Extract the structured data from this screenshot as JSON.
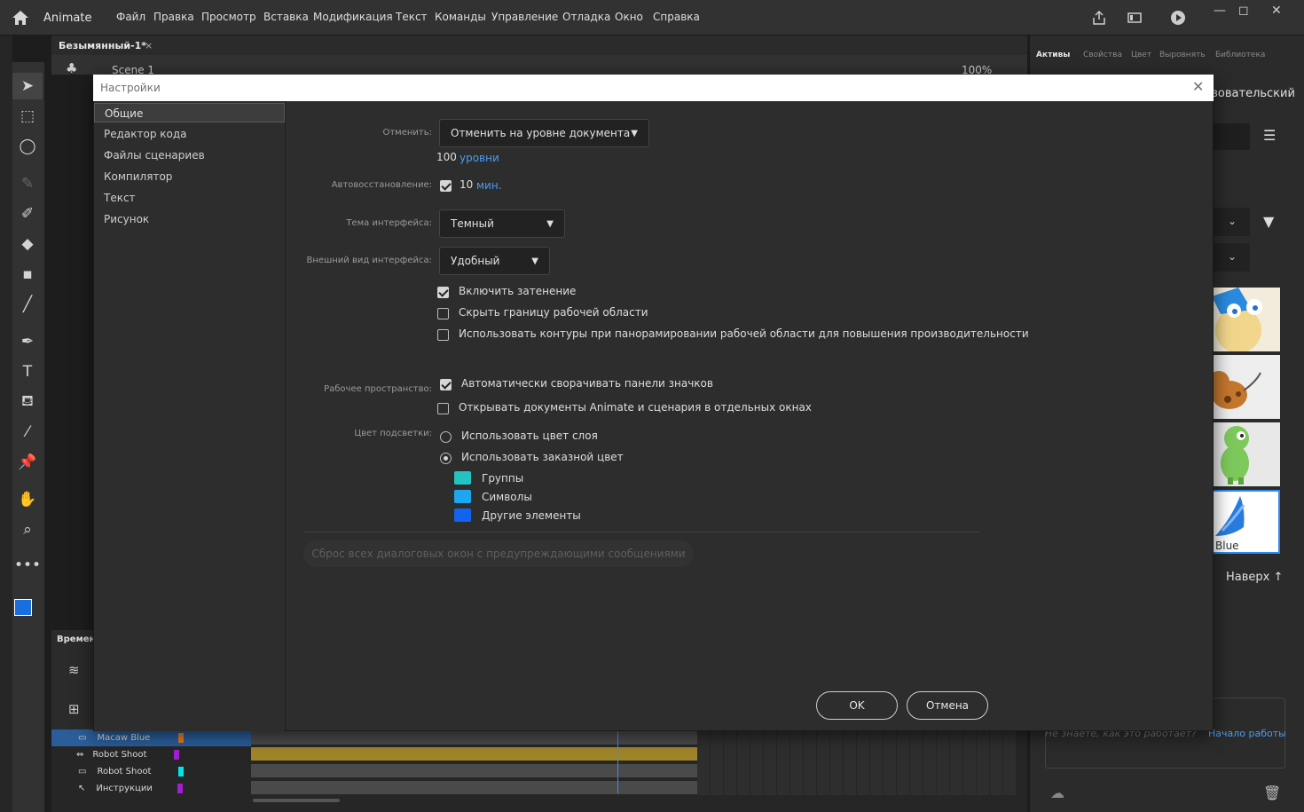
{
  "app": {
    "name": "Animate",
    "menu": [
      "Файл",
      "Правка",
      "Просмотр",
      "Вставка",
      "Модификация",
      "Текст",
      "Команды",
      "Управление",
      "Отладка",
      "Окно",
      "Справка"
    ]
  },
  "document": {
    "tab_title": "Безымянный-1*",
    "scene": "Scene 1",
    "zoom": "100%"
  },
  "right_panel": {
    "tabs": [
      "Активы",
      "Свойства",
      "Цвет",
      "Выровнять",
      "Библиотека"
    ],
    "partial_title": "зовательский",
    "thumb_label": "Blue",
    "up_label": "Наверх",
    "hint_text": "Не знаете, как это работает?",
    "hint_link": "Начало работы"
  },
  "timeline": {
    "label": "Времен",
    "layers": [
      {
        "name": "Macaw Blue",
        "color": "#e87d1e"
      },
      {
        "name": "Robot Shoot",
        "color": "#a020d0"
      },
      {
        "name": "Robot Shoot",
        "color": "#00e5e5"
      },
      {
        "name": "Инструкции",
        "color": "#a020d0"
      }
    ]
  },
  "dialog": {
    "title": "Настройки",
    "categories": [
      "Общие",
      "Редактор кода",
      "Файлы сценариев",
      "Компилятор",
      "Текст",
      "Рисунок"
    ],
    "undo_label": "Отменить:",
    "undo_value": "Отменить на уровне документа",
    "undo_levels_num": "100",
    "undo_levels_unit": "уровни",
    "autorecover_label": "Автовосстановление:",
    "autorecover_num": "10",
    "autorecover_unit": "мин.",
    "theme_label": "Тема интерфейса:",
    "theme_value": "Темный",
    "look_label": "Внешний вид интерфейса:",
    "look_value": "Удобный",
    "opt_shading": "Включить затенение",
    "opt_hide_border": "Скрыть границу рабочей области",
    "opt_outlines": "Использовать контуры при панорамировании рабочей области для повышения производительности",
    "workspace_label": "Рабочее пространство:",
    "ws_autocollapse": "Автоматически сворачивать панели значков",
    "ws_separate": "Открывать документы Animate и сценария в отдельных окнах",
    "highlight_label": "Цвет подсветки:",
    "hl_layer": "Использовать цвет слоя",
    "hl_custom": "Использовать заказной цвет",
    "hl_groups": "Группы",
    "hl_symbols": "Символы",
    "hl_other": "Другие элементы",
    "hl_colors": {
      "groups": "#23c3c3",
      "symbols": "#1ea7f0",
      "other": "#1264f0"
    },
    "reset_button": "Сброс всех диалоговых окон с предупреждающими сообщениями",
    "ok": "OK",
    "cancel": "Отмена"
  }
}
